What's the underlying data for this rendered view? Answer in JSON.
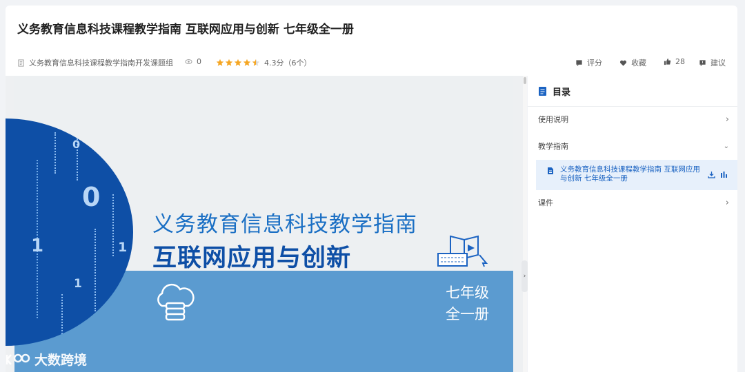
{
  "page": {
    "title": "义务教育信息科技课程教学指南 互联网应用与创新 七年级全一册",
    "author": "义务教育信息科技课程教学指南开发课题组",
    "views": "0",
    "rating_text": "4.3分（6个）",
    "rating_value": 4.3,
    "actions": {
      "rate": "评分",
      "favorite": "收藏",
      "likes": "28",
      "suggest": "建议"
    }
  },
  "cover": {
    "line1": "义务教育信息科技教学指南",
    "line2": "互联网应用与创新",
    "grade_line1": "七年级",
    "grade_line2": "全一册",
    "digits": [
      "0",
      "1",
      "0",
      "1",
      "1",
      "1",
      "0"
    ]
  },
  "watermark": {
    "text": "大数跨境"
  },
  "sidebar": {
    "heading": "目录",
    "items": [
      {
        "label": "使用说明"
      },
      {
        "label": "教学指南"
      },
      {
        "label": "课件"
      }
    ],
    "active_doc": "义务教育信息科技课程教学指南 互联网应用与创新 七年级全一册"
  },
  "colors": {
    "accent": "#1b63c2",
    "cover_blue": "#0e4fa6",
    "band_blue": "#5b9bd0",
    "star": "#f5a623"
  }
}
